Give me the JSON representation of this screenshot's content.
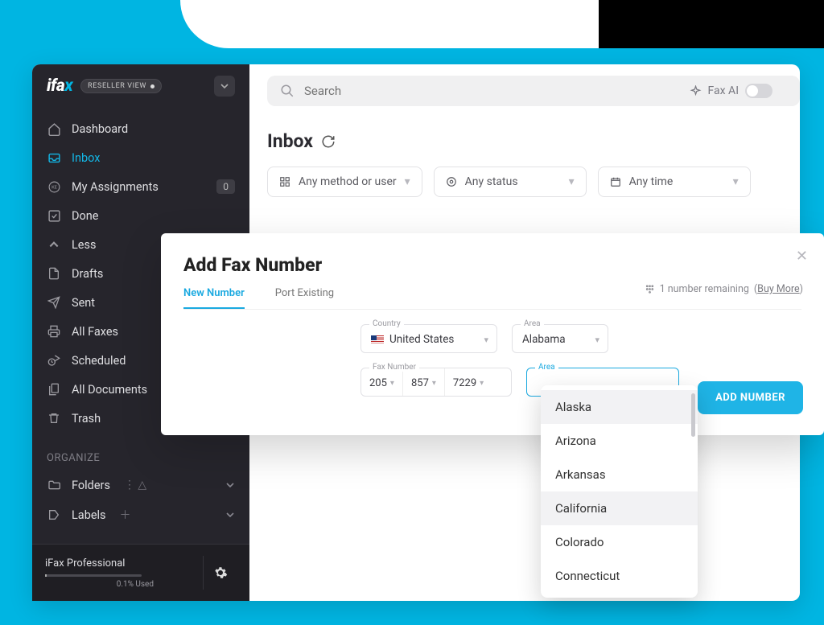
{
  "brand": {
    "name_pre": "ifa",
    "name_x": "x",
    "reseller_label": "RESELLER VIEW"
  },
  "sidebar": {
    "items": [
      {
        "label": "Dashboard"
      },
      {
        "label": "Inbox"
      },
      {
        "label": "My Assignments",
        "badge": "0"
      },
      {
        "label": "Done"
      },
      {
        "label": "Less"
      },
      {
        "label": "Drafts"
      },
      {
        "label": "Sent"
      },
      {
        "label": "All Faxes"
      },
      {
        "label": "Scheduled"
      },
      {
        "label": "All Documents"
      },
      {
        "label": "Trash"
      }
    ],
    "organize_header": "ORGANIZE",
    "folders_label": "Folders",
    "labels_label": "Labels",
    "plan_name": "iFax Professional",
    "plan_used": "0.1% Used"
  },
  "topbar": {
    "search_placeholder": "Search",
    "faxai_label": "Fax AI"
  },
  "page": {
    "title": "Inbox",
    "filters": {
      "method": "Any method or user",
      "status": "Any status",
      "time": "Any time"
    }
  },
  "modal": {
    "title": "Add Fax Number",
    "tab_new": "New Number",
    "tab_port": "Port Existing",
    "remaining_text": "1 number remaining",
    "buy_more": "Buy More",
    "country_label": "Country",
    "country_value": "United States",
    "area_label": "Area",
    "area_value": "Alabama",
    "area_label2": "Area",
    "faxnum_label": "Fax Number",
    "seg1": "205",
    "seg2": "857",
    "seg3": "7229",
    "add_button": "ADD NUMBER",
    "area_options": [
      "Alaska",
      "Arizona",
      "Arkansas",
      "California",
      "Colorado",
      "Connecticut"
    ]
  }
}
